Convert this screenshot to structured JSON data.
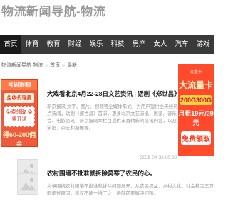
{
  "header": {
    "site_title": "物流新闻导航-物流"
  },
  "nav": {
    "items": [
      {
        "label": "首页",
        "active": true
      },
      {
        "label": "体育",
        "active": false
      },
      {
        "label": "教育",
        "active": false
      },
      {
        "label": "财经",
        "active": false
      },
      {
        "label": "娱乐",
        "active": false
      },
      {
        "label": "科技",
        "active": false
      },
      {
        "label": "房产",
        "active": false
      },
      {
        "label": "女人",
        "active": false
      },
      {
        "label": "汽车",
        "active": false
      },
      {
        "label": "游戏",
        "active": false
      }
    ]
  },
  "breadcrumb": {
    "items": [
      "物流新闻导航-物流",
      "首页",
      "最新"
    ],
    "separator": "»"
  },
  "ads": {
    "left": {
      "top": "号码限制",
      "tag": "免收代理费",
      "card": "免费领取 免费开通",
      "big": "得60-200佣金"
    },
    "right": {
      "brand": "流量卡",
      "title": "大流量卡",
      "data": "200G300G",
      "price": "月租19元/29元",
      "free": "免费领取"
    }
  },
  "articles": [
    {
      "title": "大戏看北京4月22-28日文艺资讯 | 话剧《郑世昌》首演",
      "description": "新京报讯 文字、图片、视频等全媒体形式，为用户提供全天候热点新闻，话剧《郑世昌》首演，更多北京文艺演出、展览、音乐会、电影资讯，新京报网本栏目提供丰富精彩的资讯内容，以及演出、杂志和摄像等。",
      "date": "2025-04-22 00:00"
    },
    {
      "title": "农村围墙不批准就拆除莫寒了农民的心。",
      "description": "文章围绕农村围墙不批准就拆除问题展开，从农民权益、乡村文化、社会稳定三方面阐述原因，建议不能一拆了之，拆除前要解决问题。",
      "date": ""
    }
  ],
  "colors": {
    "nav_bg": "#3a3a3a",
    "nav_active": "#1a1a1a",
    "ad_left_bg": "#f05a3c",
    "ad_right_bg": "#ff4a2c"
  }
}
